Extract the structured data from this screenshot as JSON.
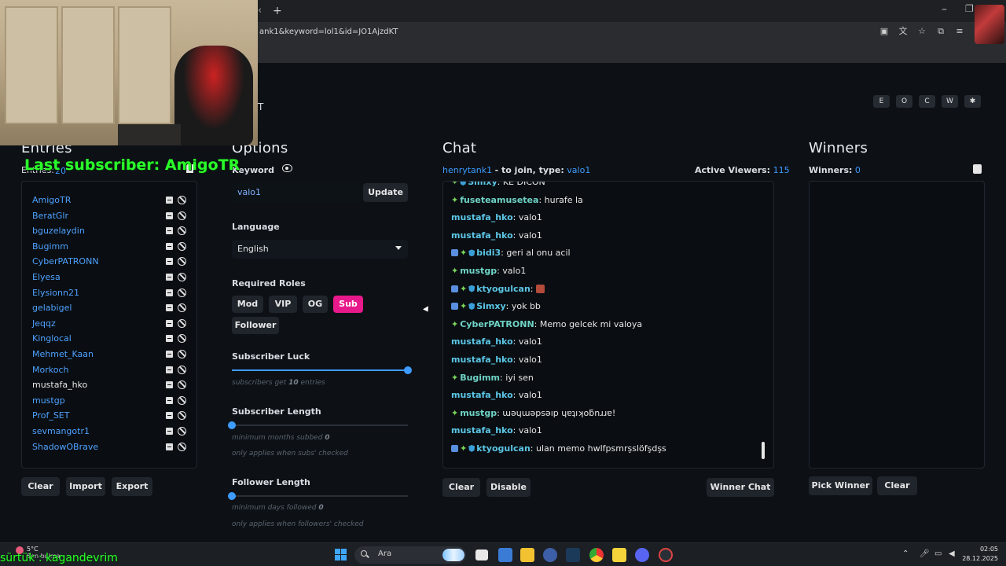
{
  "browser": {
    "new_tab": "+",
    "back": "‹",
    "url": "ank1&keyword=lol1&id=JO1AjzdKT",
    "minimize": "–",
    "maximize": "❐"
  },
  "app": {
    "brand_fragment": "T",
    "top_buttons": [
      "E",
      "O",
      "C",
      "W",
      "✱"
    ]
  },
  "entries": {
    "title": "Entries",
    "label": "Entries:",
    "count": "20",
    "items": [
      {
        "name": "AmigoTR",
        "highlight": false
      },
      {
        "name": "BeratGlr",
        "highlight": false
      },
      {
        "name": "bguzelaydin",
        "highlight": false
      },
      {
        "name": "Bugimm",
        "highlight": false
      },
      {
        "name": "CyberPATRONN",
        "highlight": false
      },
      {
        "name": "Elyesa",
        "highlight": false
      },
      {
        "name": "Elysionn21",
        "highlight": false
      },
      {
        "name": "gelabigel",
        "highlight": false
      },
      {
        "name": "Jeqqz",
        "highlight": false
      },
      {
        "name": "Kinglocal",
        "highlight": false
      },
      {
        "name": "Mehmet_Kaan",
        "highlight": false
      },
      {
        "name": "Morkoch",
        "highlight": false
      },
      {
        "name": "mustafa_hko",
        "highlight": true
      },
      {
        "name": "mustgp",
        "highlight": false
      },
      {
        "name": "Prof_SET",
        "highlight": false
      },
      {
        "name": "sevmangotr1",
        "highlight": false
      },
      {
        "name": "ShadowOBrave",
        "highlight": false
      }
    ],
    "buttons": {
      "clear": "Clear",
      "import": "Import",
      "export": "Export"
    }
  },
  "options": {
    "title": "Options",
    "keyword_label": "Keyword",
    "keyword_value": "valo1",
    "update_button": "Update",
    "language_label": "Language",
    "language_value": "English",
    "roles_label": "Required Roles",
    "roles": [
      {
        "label": "Mod",
        "active": false
      },
      {
        "label": "VIP",
        "active": false
      },
      {
        "label": "OG",
        "active": false
      },
      {
        "label": "Sub",
        "active": true
      },
      {
        "label": "Follower",
        "active": false
      }
    ],
    "sub_luck_label": "Subscriber Luck",
    "sub_luck_value": 10,
    "sub_luck_max": 10,
    "sub_luck_hint_pre": "subscribers get",
    "sub_luck_hint_num": "10",
    "sub_luck_hint_post": "entries",
    "sub_length_label": "Subscriber Length",
    "sub_length_value": 0,
    "sub_length_hint_pre": "minimum months subbed",
    "sub_length_hint_num": "0",
    "sub_length_hint2": "only applies when subs' checked",
    "follow_length_label": "Follower Length",
    "follow_length_value": 0,
    "follow_length_hint_pre": "minimum days followed",
    "follow_length_hint_num": "0",
    "follow_length_hint2": "only applies when followers' checked"
  },
  "chat": {
    "title": "Chat",
    "channel": "henrytank1",
    "join_text": "- to join, type:",
    "join_keyword": "valo1",
    "viewers_label": "Active Viewers:",
    "viewers_count": "115",
    "messages": [
      {
        "user": "Simxy",
        "text": "KE DICON",
        "badges": "gs"
      },
      {
        "user": "fuseteamusetea",
        "text": "hurafe la",
        "badges": "g"
      },
      {
        "user": "mustafa_hko",
        "text": "valo1",
        "badges": ""
      },
      {
        "user": "mustafa_hko",
        "text": "valo1",
        "badges": ""
      },
      {
        "user": "bidi3",
        "text": "geri al onu acil",
        "badges": "bgs"
      },
      {
        "user": "mustgp",
        "text": "valo1",
        "badges": "g"
      },
      {
        "user": "ktyogulcan",
        "text": "",
        "badges": "bgs",
        "emote": true
      },
      {
        "user": "Simxy",
        "text": "yok bb",
        "badges": "bgs"
      },
      {
        "user": "CyberPATRONN",
        "text": "Memo gelcek mi valoya",
        "badges": "g"
      },
      {
        "user": "mustafa_hko",
        "text": "valo1",
        "badges": ""
      },
      {
        "user": "mustafa_hko",
        "text": "valo1",
        "badges": ""
      },
      {
        "user": "Bugimm",
        "text": "iyi sen",
        "badges": "g"
      },
      {
        "user": "mustafa_hko",
        "text": "valo1",
        "badges": ""
      },
      {
        "user": "mustgp",
        "text": "ɯǝɥɯǝpsǝıp ɥɐʇıʞoƃnɹɹɐ!",
        "badges": "g"
      },
      {
        "user": "mustafa_hko",
        "text": "valo1",
        "badges": ""
      },
      {
        "user": "ktyogulcan",
        "text": "ulan memo hwlfpsmrşslöfşdşs",
        "badges": "bgs"
      }
    ],
    "buttons": {
      "clear": "Clear",
      "disable": "Disable",
      "winner_chat": "Winner Chat"
    }
  },
  "winners": {
    "title": "Winners",
    "label": "Winners:",
    "count": "0",
    "buttons": {
      "pick": "Pick Winner",
      "clear": "Clear"
    }
  },
  "overlay": {
    "last_subscriber": "Last subscriber: AmigoTR",
    "bottom_text": "sürtük : kagandevrim"
  },
  "taskbar": {
    "temperature": "5°C",
    "weather_sub": "Son bulma",
    "search_placeholder": "Ara",
    "time": "02:05",
    "date": "28.12.2025"
  }
}
